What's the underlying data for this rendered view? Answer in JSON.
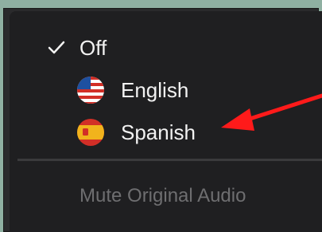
{
  "menu": {
    "items": [
      {
        "label": "Off",
        "checked": true
      },
      {
        "label": "English",
        "icon": "us-flag-icon"
      },
      {
        "label": "Spanish",
        "icon": "spain-flag-icon"
      }
    ],
    "mute_label": "Mute Original Audio"
  },
  "annotation": {
    "arrow_color": "#ff1a1a"
  }
}
